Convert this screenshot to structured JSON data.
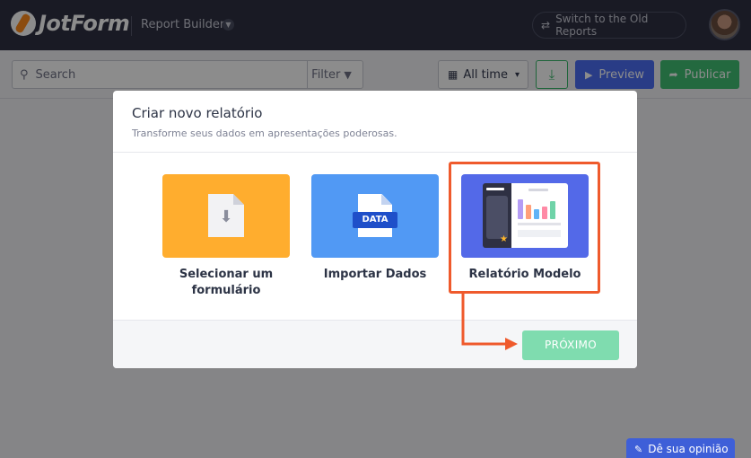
{
  "header": {
    "logo_text": "JotForm",
    "app_name": "Report Builder",
    "old_reports_label": "Switch to the Old Reports"
  },
  "toolbar": {
    "search_placeholder": "Search",
    "filter_label": "Filter",
    "date_range": "All time",
    "preview_label": "Preview",
    "publish_label": "Publicar"
  },
  "modal": {
    "title": "Criar novo relatório",
    "subtitle": "Transforme seus dados em apresentações poderosas.",
    "options": [
      {
        "label": "Selecionar um formulário",
        "icon": "form-import-icon",
        "color": "#ffad2e"
      },
      {
        "label": "Importar Dados",
        "icon": "data-file-icon",
        "badge": "DATA",
        "color": "#5199f4"
      },
      {
        "label": "Relatório Modelo",
        "icon": "report-template-icon",
        "color": "#5369e8",
        "selected": true
      }
    ],
    "next_label": "PRÓXIMO"
  },
  "feedback_label": "Dê sua opinião",
  "colors": {
    "header_bg": "#2e3043",
    "accent_green": "#40c074",
    "accent_blue": "#4c6ef5",
    "highlight": "#ef5a2c"
  }
}
